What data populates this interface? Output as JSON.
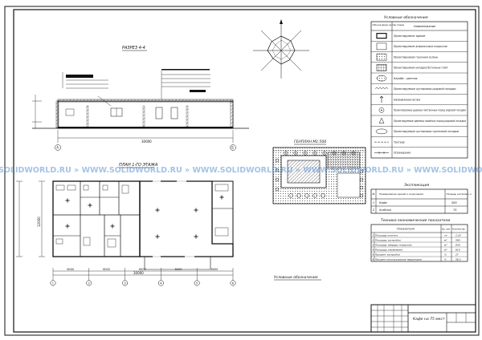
{
  "section": {
    "title": "РАЗРЕЗ 4-4",
    "axis_a": "А",
    "axis_b": "Б",
    "dim": "30000"
  },
  "plan": {
    "title": "ПЛАН 1-ГО ЭТАЖА",
    "dim_left": "12000",
    "dim_total": "30000",
    "dims_bottom": [
      "6000",
      "6000",
      "6000",
      "6000",
      "6000"
    ],
    "axes_x": [
      "1",
      "2",
      "3",
      "4",
      "5",
      "6"
    ]
  },
  "genplan": {
    "title": "ГЕНПЛАН М1:500"
  },
  "legend": {
    "title": "Условные обозначения",
    "header": [
      "Обозначение на ген.плане",
      "Наименование"
    ],
    "items": [
      "Проектируемое здание",
      "Проектируемое асфальтовое покрытие",
      "Проектируемая газонная зелень",
      "Проектируемая укладка бетонных плит",
      "Клумба - цветник",
      "Проектируемые кустарники рядовой посадки",
      "Направление ветра",
      "Проектируемые деревья лиственных пород рядовой посадки",
      "Проектируемые деревья хвойных пород рядовой посадки",
      "Проектируемые кустарники групповой посадки",
      "Тротуар",
      "Ограждение"
    ]
  },
  "explication": {
    "title": "Экспликация",
    "header": [
      "№",
      "Наименование зданий и сооружений",
      "Площадь застройки, м"
    ],
    "rows": [
      {
        "n": "1",
        "name": "Кафе",
        "area": "585"
      },
      {
        "n": "2",
        "name": "Хозблок",
        "area": "75"
      }
    ]
  },
  "tep": {
    "title": "Технико-экономические показатели",
    "header": [
      "Показатели",
      "Ед. изм.",
      "Количество"
    ],
    "rows": [
      {
        "n": "1",
        "name": "Площадь участка",
        "unit": "га",
        "value": "2,20"
      },
      {
        "n": "2",
        "name": "Площадь застройки",
        "unit": "м²",
        "value": "585"
      },
      {
        "n": "3",
        "name": "Площадь твердых покрытий",
        "unit": "м²",
        "value": "930"
      },
      {
        "n": "4",
        "name": "Площадь озеленения",
        "unit": "м²",
        "value": "615"
      },
      {
        "n": "5",
        "name": "Процент застройки",
        "unit": "%",
        "value": "27"
      },
      {
        "n": "6",
        "name": "Процент использования территории",
        "unit": "%",
        "value": "58,3"
      }
    ]
  },
  "note": "Условные обозначения",
  "title_block": {
    "text": "Кафе на 75 мест"
  },
  "watermark": "SOLIDWORLD.RU » WWW.SOLIDWORLD.RU » WWW.SOLIDWORLD.RU » WWW.SOLIDWORLD.RU » WWW.SOLIDWORLD.RU"
}
